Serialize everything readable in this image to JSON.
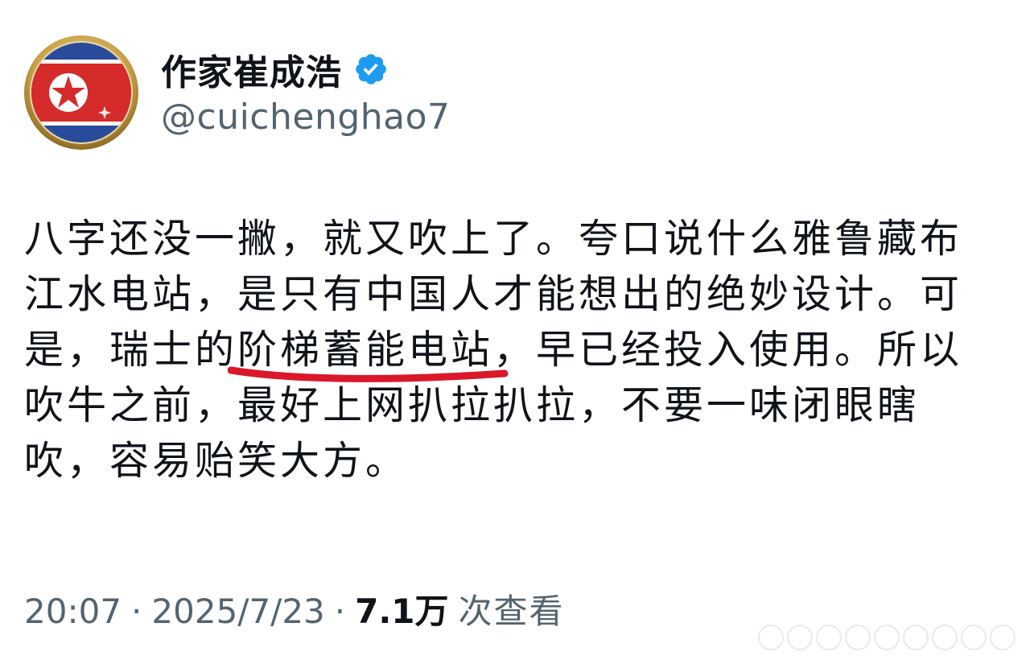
{
  "author": {
    "display_name": "作家崔成浩",
    "handle": "@cuichenghao7",
    "verified": true,
    "verified_color": "#1d9bf0",
    "avatar_icon": "north-korea-flag-badge-icon"
  },
  "tweet": {
    "lines": {
      "l1": "八字还没一撇，就又吹上了。夸口说什么雅鲁藏布",
      "l2": "江水电站，是只有中国人才能想出的绝妙设计。可",
      "l3_before": "是，瑞士的",
      "l3_highlight": "阶梯蓄能电站",
      "l3_after": "，早已经投入使用。所以",
      "l4": "吹牛之前，最好上网扒拉扒拉，不要一味闭眼瞎",
      "l5": "吹，容易贻笑大方。"
    },
    "underline_color": "#d9182a"
  },
  "meta": {
    "time": "20:07",
    "separator": "·",
    "date": "2025/7/23",
    "views_count": "7.1万",
    "views_label": "次查看"
  }
}
